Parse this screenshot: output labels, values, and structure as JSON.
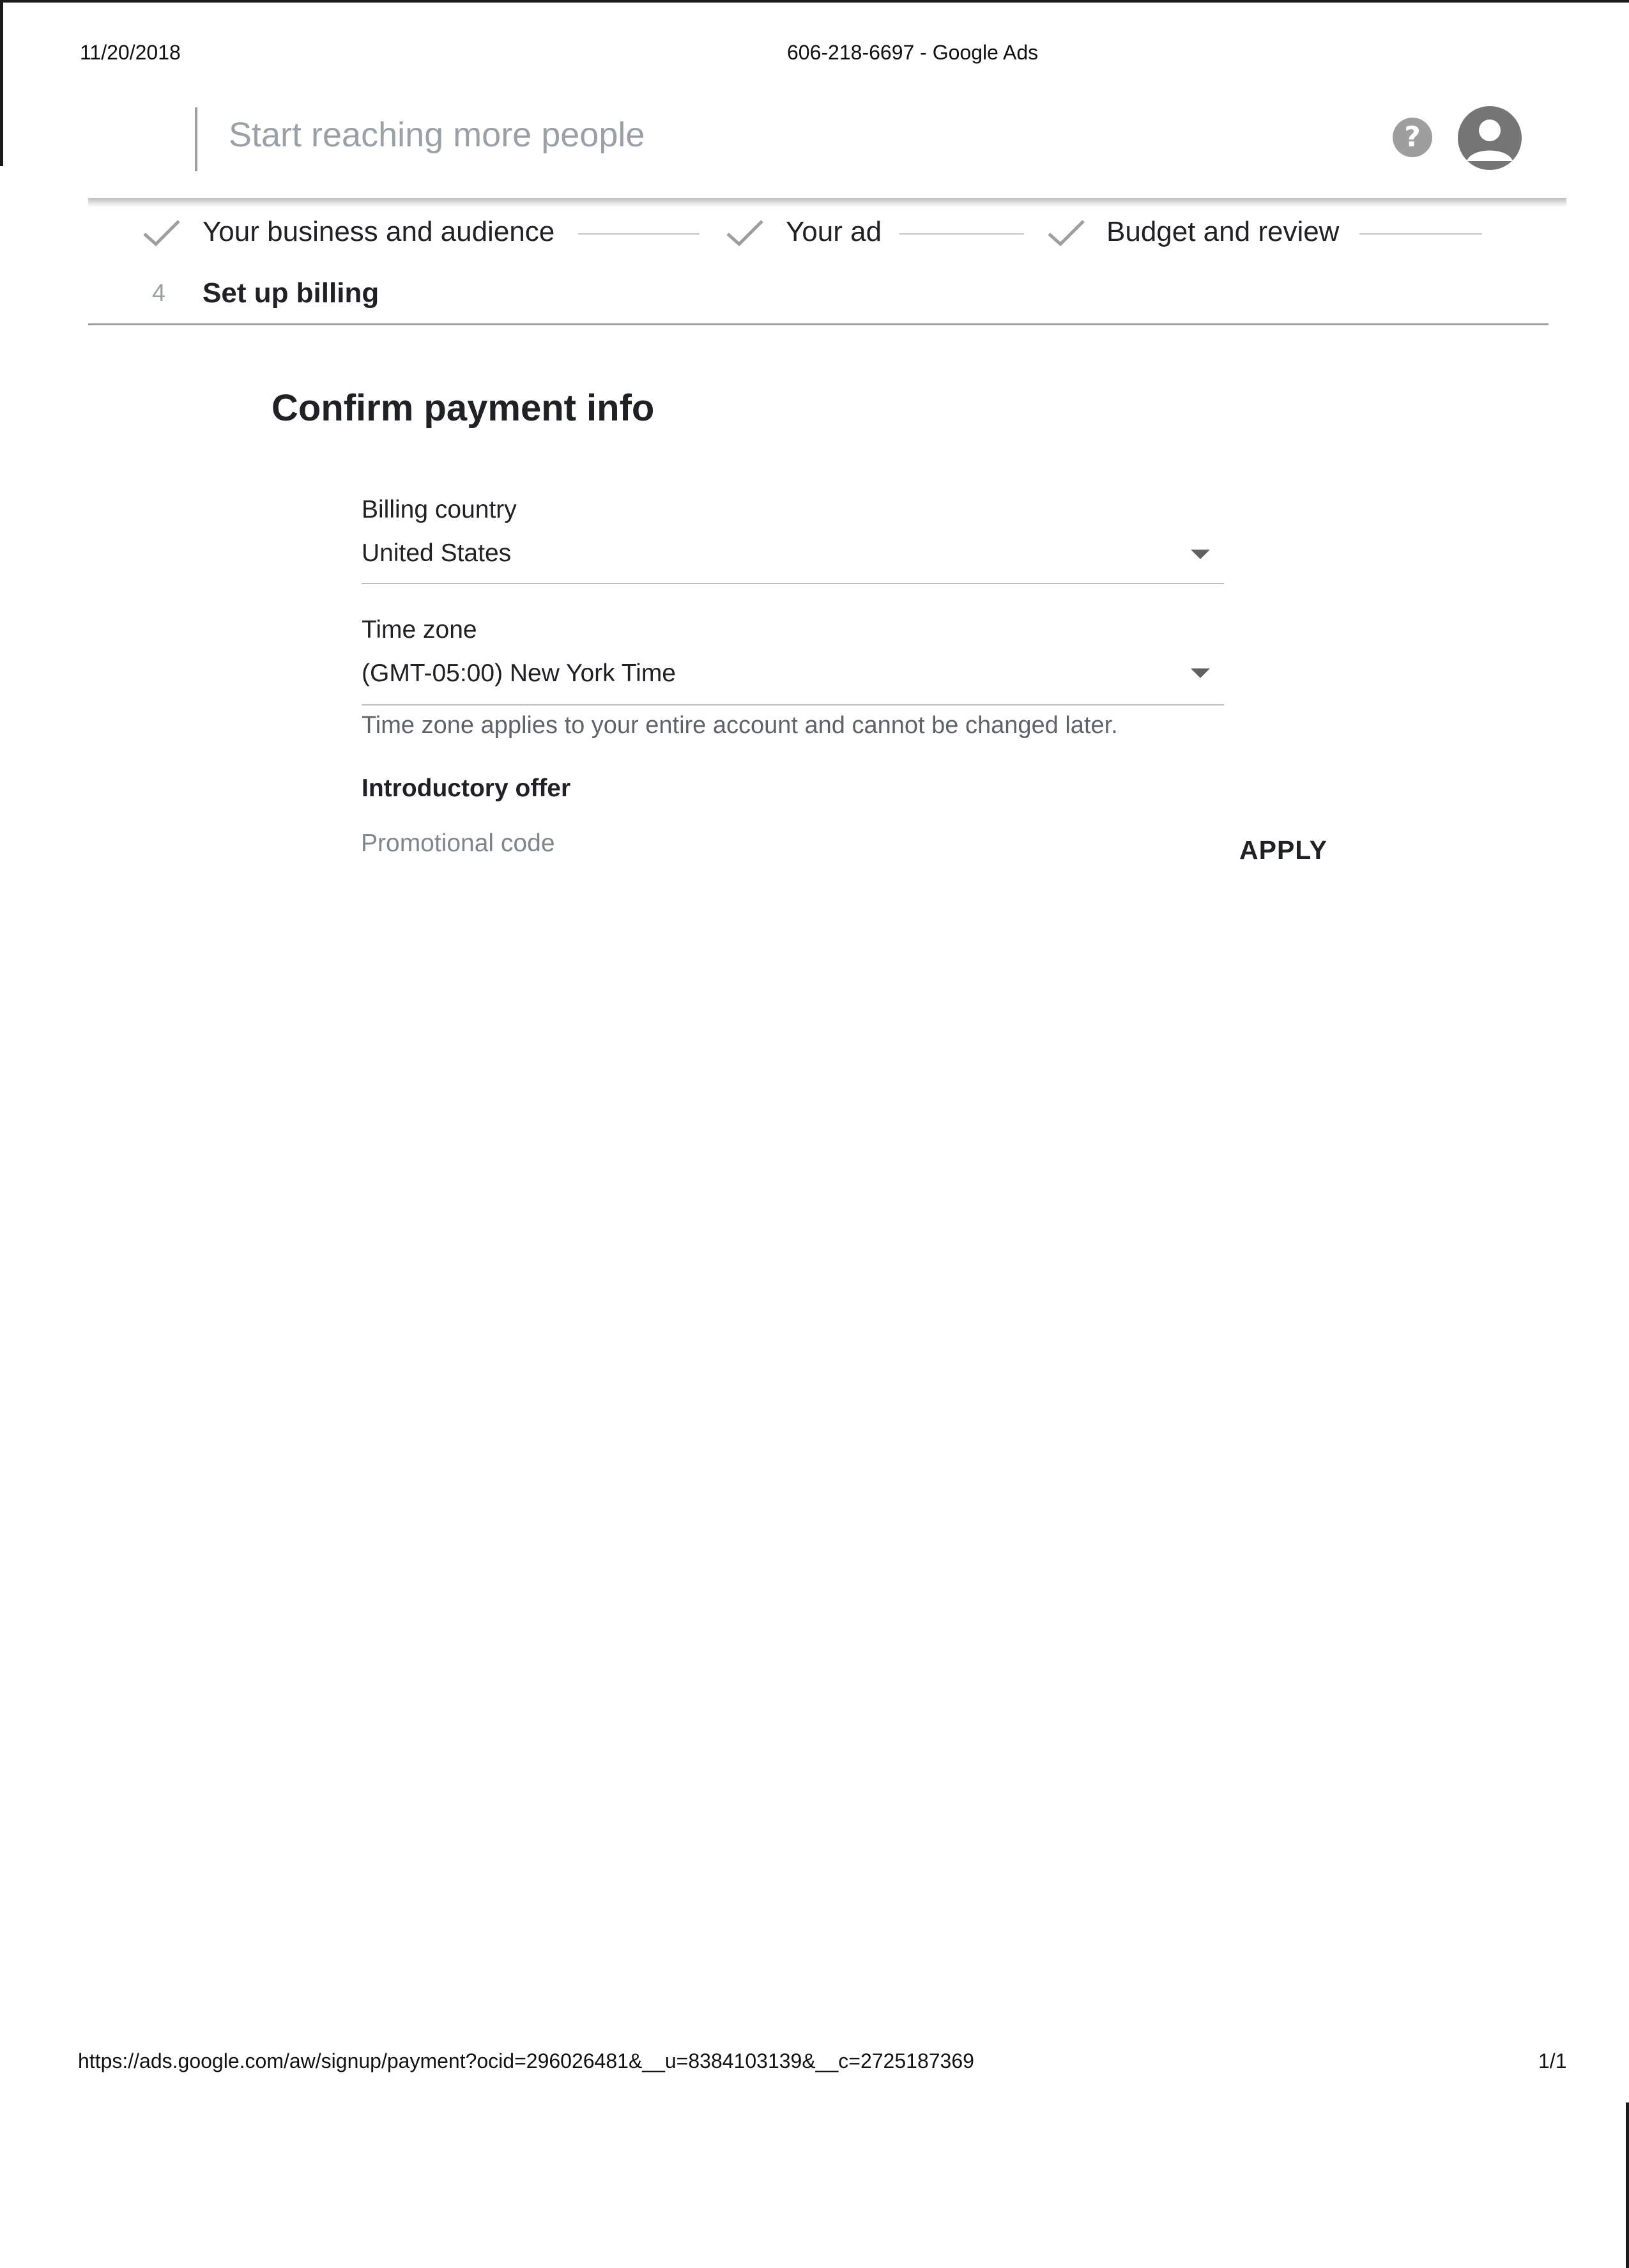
{
  "print_header": {
    "date": "11/20/2018",
    "page_title": "606-218-6697 - Google Ads"
  },
  "app_header": {
    "title": "Start reaching more people",
    "help_icon": "help-circle-icon",
    "avatar_icon": "account-circle-icon"
  },
  "stepper": {
    "steps": [
      {
        "label": "Your business and audience",
        "status": "complete"
      },
      {
        "label": "Your ad",
        "status": "complete"
      },
      {
        "label": "Budget and review",
        "status": "complete"
      },
      {
        "number": "4",
        "label": "Set up billing",
        "status": "active"
      }
    ]
  },
  "form": {
    "title": "Confirm payment info",
    "billing_country": {
      "label": "Billing country",
      "value": "United States"
    },
    "time_zone": {
      "label": "Time zone",
      "value": "(GMT-05:00) New York Time",
      "helper": "Time zone applies to your entire account and cannot be changed later."
    },
    "introductory_offer": {
      "heading": "Introductory offer",
      "promo_placeholder": "Promotional code",
      "apply_label": "APPLY"
    }
  },
  "print_footer": {
    "url": "https://ads.google.com/aw/signup/payment?ocid=296026481&__u=8384103139&__c=2725187369",
    "page_number": "1/1"
  },
  "colors": {
    "text": "#202124",
    "muted_text": "#5f6368",
    "placeholder": "#80868b",
    "icon_gray": "#9e9e9e",
    "avatar_gray": "#757575"
  }
}
